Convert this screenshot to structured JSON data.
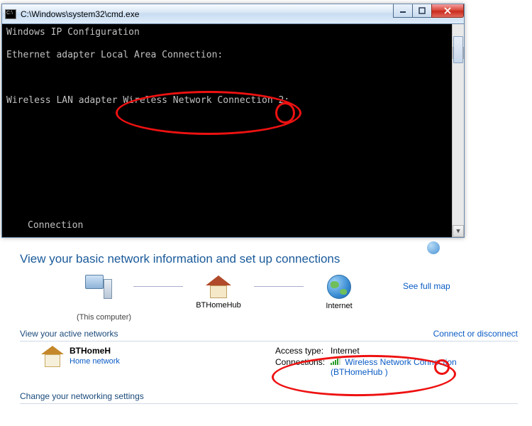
{
  "cmd": {
    "title": "C:\\Windows\\system32\\cmd.exe",
    "lines": {
      "l1": "Windows IP Configuration",
      "l2": "Ethernet adapter Local Area Connection:",
      "l3": "Wireless LAN adapter Wireless Network Connection 2:",
      "l4": "Connection",
      "annotation_fragment": "2:"
    },
    "buttons": {
      "min": "—",
      "max": "▢",
      "close": "✕"
    }
  },
  "ncp": {
    "heading": "View your basic network information and set up connections",
    "full_map": "See full map",
    "this_computer": "(This computer)",
    "node_router": "BTHomeHub",
    "node_internet": "Internet",
    "view_active": "View your active networks",
    "connect_link": "Connect or disconnect",
    "network_name": "BTHomeH",
    "home_network": "Home network",
    "access_type_k": "Access type:",
    "access_type_v": "Internet",
    "connections_k": "Connections:",
    "conn_name": "Wireless Network Connection",
    "conn_ssid": "(BTHomeHub          )",
    "change_settings": "Change your networking settings"
  }
}
